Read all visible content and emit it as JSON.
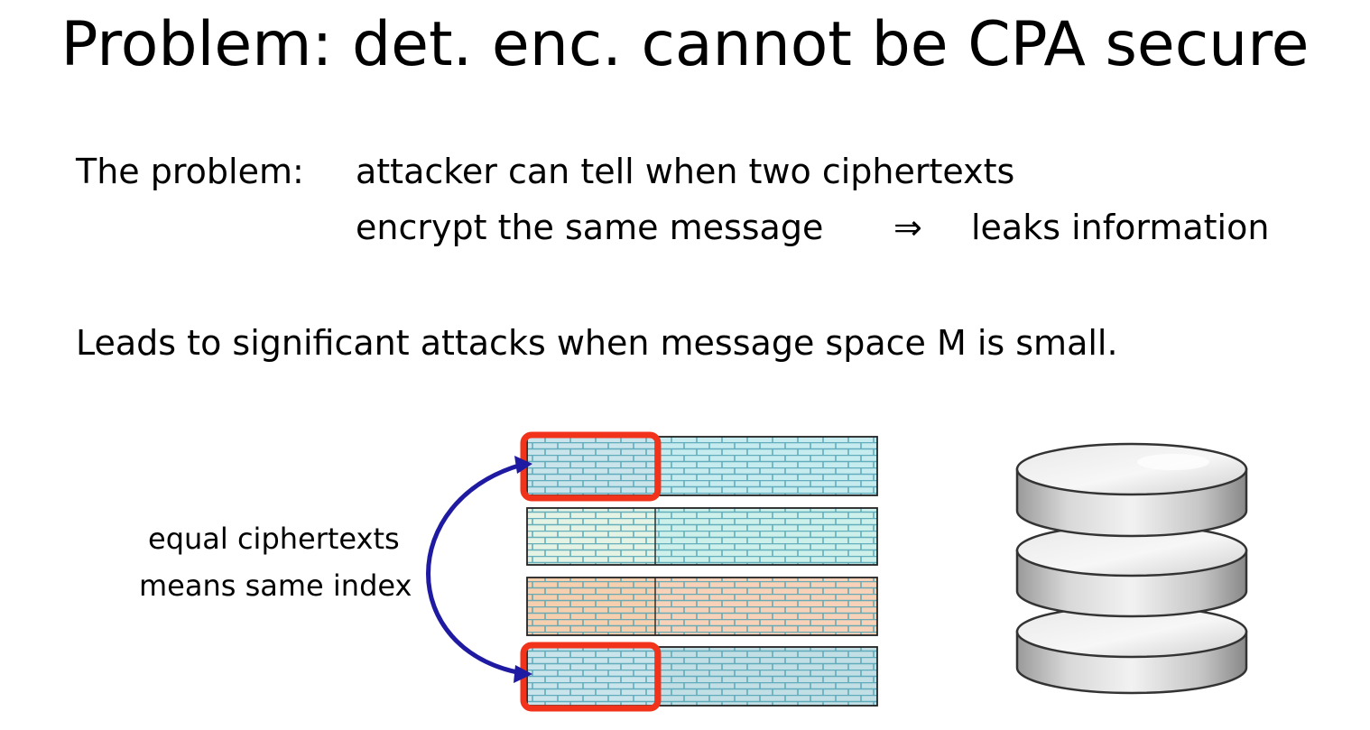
{
  "slide": {
    "title": "Problem:  det. enc. cannot be CPA secure",
    "problem_intro": "The problem:",
    "problem_line1": "attacker can tell when two ciphertexts",
    "problem_line2": "encrypt the same message",
    "implies_symbol": "⇒",
    "problem_consequence": "leaks information",
    "attacks_line": "Leads to significant attacks when message space M is small."
  },
  "diagram": {
    "annotation_line1": "equal ciphertexts",
    "annotation_line2": "means same index",
    "rows": [
      {
        "index_fill": "#c9e4ea",
        "data_fill": "#c7ecef",
        "highlighted": true
      },
      {
        "index_fill": "#e4f3e4",
        "data_fill": "#cdf1ea",
        "highlighted": false
      },
      {
        "index_fill": "#f6cfaf",
        "data_fill": "#f7d2b8",
        "highlighted": false
      },
      {
        "index_fill": "#c9e4ea",
        "data_fill": "#c2dfe5",
        "highlighted": true
      }
    ],
    "colors": {
      "highlight": "#f0331a",
      "arrow": "#1f1aa2",
      "brick_line": "#4fa2b4",
      "database_body": "#cfcfcf"
    },
    "icons": [
      "database-icon"
    ]
  }
}
